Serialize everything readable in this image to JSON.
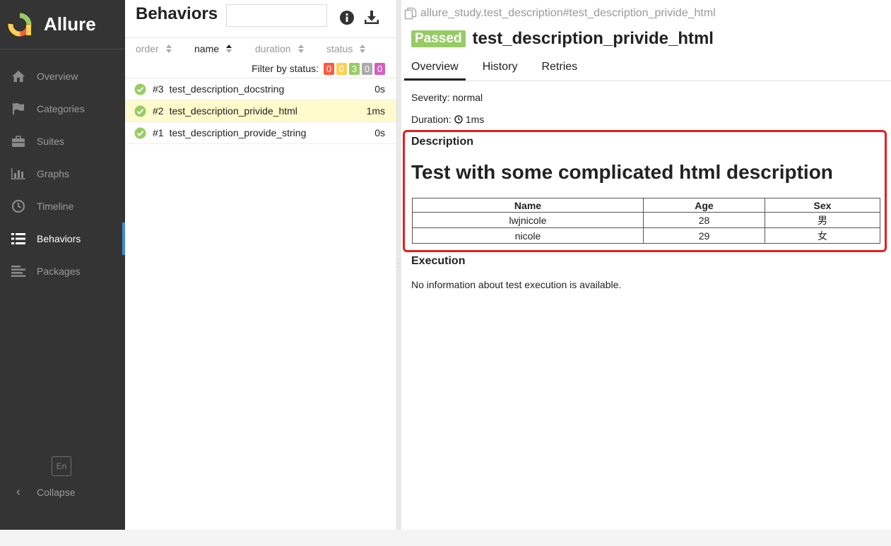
{
  "sidebar": {
    "brand": "Allure",
    "items": [
      {
        "label": "Overview",
        "icon": "home-icon"
      },
      {
        "label": "Categories",
        "icon": "flag-icon"
      },
      {
        "label": "Suites",
        "icon": "briefcase-icon"
      },
      {
        "label": "Graphs",
        "icon": "bar-chart-icon"
      },
      {
        "label": "Timeline",
        "icon": "clock-icon"
      },
      {
        "label": "Behaviors",
        "icon": "list-icon",
        "active": true
      },
      {
        "label": "Packages",
        "icon": "align-left-icon"
      }
    ],
    "language": "En",
    "collapse": "Collapse"
  },
  "middle": {
    "title": "Behaviors",
    "search": {
      "value": "",
      "placeholder": ""
    },
    "sort": {
      "order": "order",
      "name": "name",
      "duration": "duration",
      "status": "status"
    },
    "filter_label": "Filter by status:",
    "status_counts": [
      {
        "count": "0",
        "color": "#fd5a3e"
      },
      {
        "count": "0",
        "color": "#ffd050"
      },
      {
        "count": "3",
        "color": "#97cc64"
      },
      {
        "count": "0",
        "color": "#aaaaaa"
      },
      {
        "count": "0",
        "color": "#d35ebe"
      }
    ],
    "rows": [
      {
        "num": "#3",
        "name": "test_description_docstring",
        "duration": "0s"
      },
      {
        "num": "#2",
        "name": "test_description_privide_html",
        "duration": "1ms",
        "selected": true
      },
      {
        "num": "#1",
        "name": "test_description_provide_string",
        "duration": "0s"
      }
    ]
  },
  "detail": {
    "breadcrumb": "allure_study.test_description#test_description_privide_html",
    "status": "Passed",
    "title": "test_description_privide_html",
    "tabs": [
      "Overview",
      "History",
      "Retries"
    ],
    "severity": "Severity: normal",
    "duration_label": "Duration:",
    "duration_value": "1ms",
    "description_label": "Description",
    "description_heading": "Test with some complicated html description",
    "table": {
      "headers": [
        "Name",
        "Age",
        "Sex"
      ],
      "rows": [
        [
          "lwjnicole",
          "28",
          "男"
        ],
        [
          "nicole",
          "29",
          "女"
        ]
      ]
    },
    "execution_label": "Execution",
    "execution_text": "No information about test execution is available."
  },
  "colors": {
    "sidebar_bg": "#343434",
    "passed": "#97cc64",
    "highlight": "#e02020",
    "selected_row": "#fffbcc"
  }
}
